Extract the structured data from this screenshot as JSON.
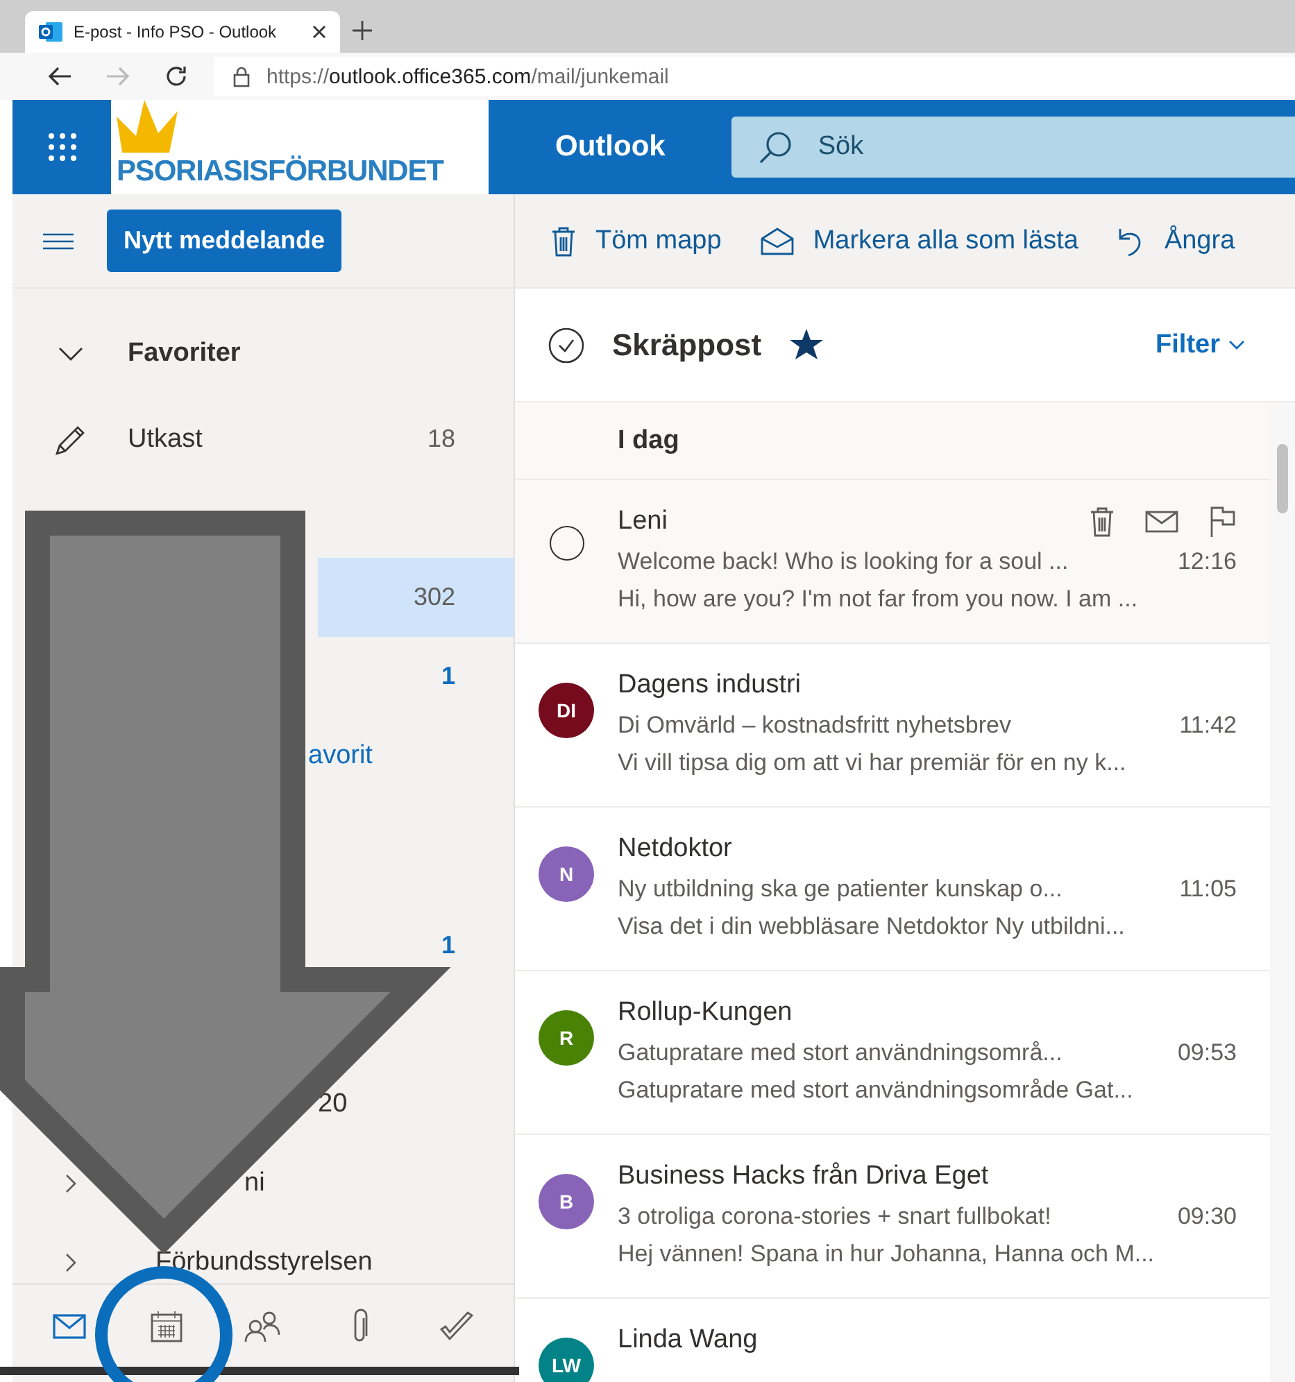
{
  "browser": {
    "tab": {
      "title": "E-post - Info PSO - Outlook"
    },
    "url": {
      "scheme": "https://",
      "host": "outlook.office365.com",
      "path": "/mail/junkemail"
    }
  },
  "header": {
    "logo": "PSORIASISFÖRBUNDET",
    "app_name": "Outlook",
    "search": {
      "placeholder": "Sök"
    }
  },
  "sidebar": {
    "new_message": "Nytt meddelande",
    "items": [
      {
        "kind": "header",
        "label": "Favoriter",
        "selected": false
      },
      {
        "kind": "folder",
        "label": "Utkast",
        "count": "18",
        "selected": false
      },
      {
        "kind": "covered",
        "selected": false
      },
      {
        "kind": "folder",
        "count": "302",
        "selected": true
      },
      {
        "kind": "folder",
        "count": "1",
        "unread": true,
        "selected": false
      },
      {
        "kind": "link",
        "label": "avorit",
        "selected": false
      },
      {
        "kind": "gap",
        "selected": false
      },
      {
        "kind": "folder",
        "count": "1",
        "unread": true,
        "selected": false
      },
      {
        "kind": "covered",
        "selected": false
      },
      {
        "kind": "folder",
        "label": "20",
        "selected": false
      },
      {
        "kind": "group-covered",
        "label": "ni",
        "selected": false
      },
      {
        "kind": "group",
        "label": "Förbundsstyrelsen",
        "selected": false
      }
    ],
    "nav": [
      {
        "selected": true
      },
      {
        "selected": false
      },
      {
        "selected": false
      },
      {
        "selected": false
      },
      {
        "selected": false
      }
    ]
  },
  "toolbar": [
    {
      "label": "Töm mapp"
    },
    {
      "label": "Markera alla som lästa"
    },
    {
      "label": "Ångra"
    }
  ],
  "folder": {
    "title": "Skräppost",
    "favorite": true,
    "filter": "Filter"
  },
  "group": "I dag",
  "messages": [
    {
      "sender": "Leni",
      "subject": "Welcome back! Who is looking for a soul ...",
      "time": "12:16",
      "preview": "Hi, how are you? I'm not far from you now. I am ...",
      "hovered": true
    },
    {
      "sender": "Dagens industri",
      "initials": "DI",
      "color": "#750b1c",
      "subject": "Di Omvärld – kostnadsfritt nyhetsbrev",
      "time": "11:42",
      "preview": "Vi vill tipsa dig om att vi har premiär för en ny k...",
      "hovered": false
    },
    {
      "sender": "Netdoktor",
      "initials": "N",
      "color": "#8764b8",
      "subject": "Ny utbildning ska ge patienter kunskap o...",
      "time": "11:05",
      "preview": "Visa det i din webbläsare Netdoktor Ny utbildni...",
      "hovered": false
    },
    {
      "sender": "Rollup-Kungen",
      "initials": "R",
      "color": "#498205",
      "subject": "Gatupratare med stort användningsområ...",
      "time": "09:53",
      "preview": "Gatupratare med stort användningsområde Gat...",
      "hovered": false
    },
    {
      "sender": "Business Hacks från Driva Eget",
      "initials": "B",
      "color": "#8764b8",
      "subject": "3 otroliga corona-stories + snart fullbokat!",
      "time": "09:30",
      "preview": "Hej vännen! Spana in hur Johanna, Hanna och M...",
      "hovered": false
    },
    {
      "sender": "Linda Wang",
      "initials": "LW",
      "color": "#038387",
      "hovered": false
    }
  ]
}
